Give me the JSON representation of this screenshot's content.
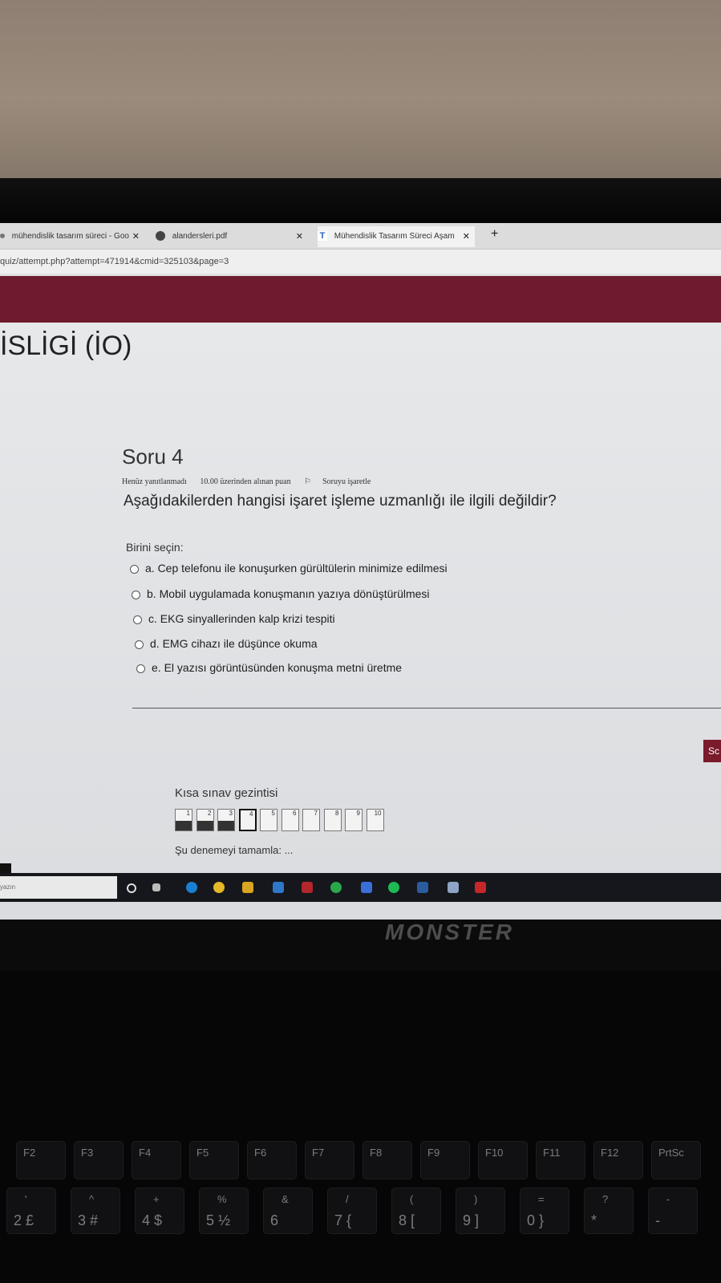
{
  "browser": {
    "tabs": [
      {
        "label": "mühendislik tasarım süreci - Goo"
      },
      {
        "label": "alandersleri.pdf"
      },
      {
        "label": "Mühendislik Tasarım Süreci Aşam"
      }
    ],
    "address": "quiz/attempt.php?attempt=471914&cmid=325103&page=3"
  },
  "course": {
    "title": "İSLİGİ (İO)"
  },
  "question": {
    "heading": "Soru 4",
    "status": "Henüz yanıtlanmadı",
    "points": "10.00 üzerinden alınan puan",
    "flag_label": "Soruyu işaretle",
    "text": "Aşağıdakilerden hangisi işaret işleme uzmanlığı ile ilgili değildir?",
    "prompt": "Birini seçin:",
    "options": [
      "a. Cep telefonu ile konuşurken gürültülerin minimize edilmesi",
      "b. Mobil uygulamada konuşmanın yazıya dönüştürülmesi",
      "c. EKG sinyallerinden kalp krizi tespiti",
      "d. EMG cihazı ile düşünce okuma",
      "e. El yazısı görüntüsünden konuşma metni üretme"
    ]
  },
  "next_button": "Sc",
  "navigation": {
    "title": "Kısa sınav gezintisi",
    "numbers": [
      "1",
      "2",
      "3",
      "4",
      "5",
      "6",
      "7",
      "8",
      "9",
      "10"
    ],
    "answered": [
      true,
      true,
      true,
      false,
      false,
      false,
      false,
      false,
      false,
      false
    ],
    "current": 4,
    "finish": "Şu denemeyi tamamla: ..."
  },
  "taskbar": {
    "search_placeholder": "yazın"
  },
  "laptop_brand": "MONSTER",
  "keyboard": {
    "fkeys": [
      "F2",
      "F3",
      "F4",
      "F5",
      "F6",
      "F7",
      "F8",
      "F9",
      "F10",
      "F11",
      "F12",
      "PrtSc"
    ],
    "numkeys": [
      {
        "top": "'",
        "bottom": "2 £"
      },
      {
        "top": "^",
        "bottom": "3 #"
      },
      {
        "top": "+",
        "bottom": "4 $"
      },
      {
        "top": "%",
        "bottom": "5 ½"
      },
      {
        "top": "&",
        "bottom": "6"
      },
      {
        "top": "/",
        "bottom": "7 {"
      },
      {
        "top": "(",
        "bottom": "8 ["
      },
      {
        "top": ")",
        "bottom": "9 ]"
      },
      {
        "top": "=",
        "bottom": "0 }"
      },
      {
        "top": "?",
        "bottom": "*"
      },
      {
        "top": "-",
        "bottom": "-"
      }
    ]
  },
  "colors": {
    "banner": "#6e1b2d",
    "taskbar": "#15171c"
  }
}
